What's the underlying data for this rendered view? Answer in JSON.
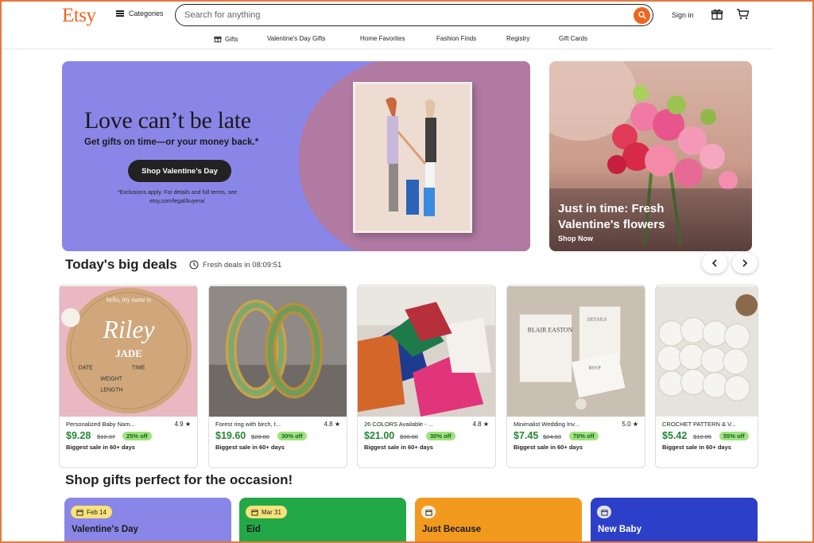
{
  "header": {
    "logo": "Etsy",
    "categories_label": "Categories",
    "search_placeholder": "Search for anything",
    "signin_label": "Sign in"
  },
  "nav": {
    "items": [
      {
        "label": "Gifts",
        "icon": "gift-icon"
      },
      {
        "label": "Valentine's Day Gifts"
      },
      {
        "label": "Home Favorites"
      },
      {
        "label": "Fashion Finds"
      },
      {
        "label": "Registry"
      },
      {
        "label": "Gift Cards"
      }
    ]
  },
  "hero": {
    "title": "Love can’t be late",
    "subtitle": "Get gifts on time—or your money back.*",
    "button": "Shop Valentine’s Day",
    "fine_print": "*Exclusions apply. For details and full terms, see etsy.com/legal/buyera/",
    "bg_color": "#8a86e8",
    "accent_color": "#b07aa3"
  },
  "flowers": {
    "title": "Just in time: Fresh Valentine's flowers",
    "link": "Shop Now"
  },
  "deals": {
    "title": "Today's big deals",
    "timer": "Fresh deals in 08:09:51",
    "items": [
      {
        "name": "Personalized Baby Nam...",
        "rating": "4.9 ★",
        "price": "$9.28",
        "original": "$12.37",
        "off": "25% off",
        "sale": "Biggest sale in 60+ days"
      },
      {
        "name": "Forest ring with birch, t...",
        "rating": "4.8 ★",
        "price": "$19.60",
        "original": "$28.00",
        "off": "30% off",
        "sale": "Biggest sale in 60+ days"
      },
      {
        "name": "26 COLORS Available - ...",
        "rating": "4.8 ★",
        "price": "$21.00",
        "original": "$30.00",
        "off": "30% off",
        "sale": "Biggest sale in 60+ days"
      },
      {
        "name": "Minimalist Wedding Inv...",
        "rating": "5.0 ★",
        "price": "$7.45",
        "original": "$24.83",
        "off": "70% off",
        "sale": "Biggest sale in 60+ days"
      },
      {
        "name": "CROCHET PATTERN & V...",
        "rating": "",
        "price": "$5.42",
        "original": "$12.05",
        "off": "55% off",
        "sale": "Biggest sale in 60+ days"
      }
    ],
    "price_color": "#258635",
    "off_badge_color": "#9ee37d"
  },
  "occasions": {
    "title": "Shop gifts perfect for the occasion!",
    "items": [
      {
        "label": "Valentine's Day",
        "date": "Feb 14",
        "color": "#8a86e8"
      },
      {
        "label": "Eid",
        "date": "Mar 31",
        "color": "#22a846"
      },
      {
        "label": "Just Because",
        "date": "",
        "color": "#f29a1e"
      },
      {
        "label": "New Baby",
        "date": "",
        "color": "#2b3fc9"
      }
    ]
  },
  "art": {
    "riley_text": "Riley",
    "jade_text": "JADE",
    "hello_text": "hello, my name is",
    "date_label": "DATE",
    "time_label": "TIME",
    "weight_label": "WEIGHT",
    "length_label": "LENGTH",
    "wedding_names": "BLAIR EASTON",
    "details_label": "DETAILS",
    "rsvp_label": "RSVP"
  },
  "brand_color": "#f1641e"
}
